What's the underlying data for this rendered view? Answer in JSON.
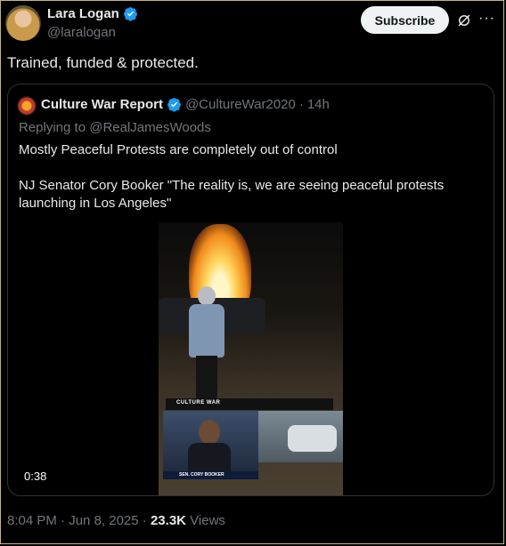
{
  "author": {
    "name": "Lara Logan",
    "handle": "@laralogan"
  },
  "actions": {
    "subscribe_label": "Subscribe",
    "more_label": "···"
  },
  "tweet": {
    "text": "Trained, funded & protected."
  },
  "quote": {
    "name": "Culture War Report",
    "handle": "@CultureWar2020",
    "separator": "·",
    "time": "14h",
    "reply_prefix": "Replying to",
    "reply_to": "@RealJamesWoods",
    "paragraphs": [
      "Mostly Peaceful Protests are completely out of control",
      "NJ Senator Cory Booker  \"The reality is, we are seeing peaceful protests launching in Los Angeles\""
    ],
    "video": {
      "duration": "0:38",
      "inset_logo": "CULTURE WAR",
      "inset_caption": "SEN. CORY BOOKER"
    }
  },
  "footer": {
    "time": "8:04 PM",
    "date": "Jun 8, 2025",
    "separator": "·",
    "views_count": "23.3K",
    "views_label": "Views"
  },
  "colors": {
    "background": "#000000",
    "text": "#e7e9ea",
    "muted": "#71767b",
    "verified": "#1d9bf0"
  }
}
